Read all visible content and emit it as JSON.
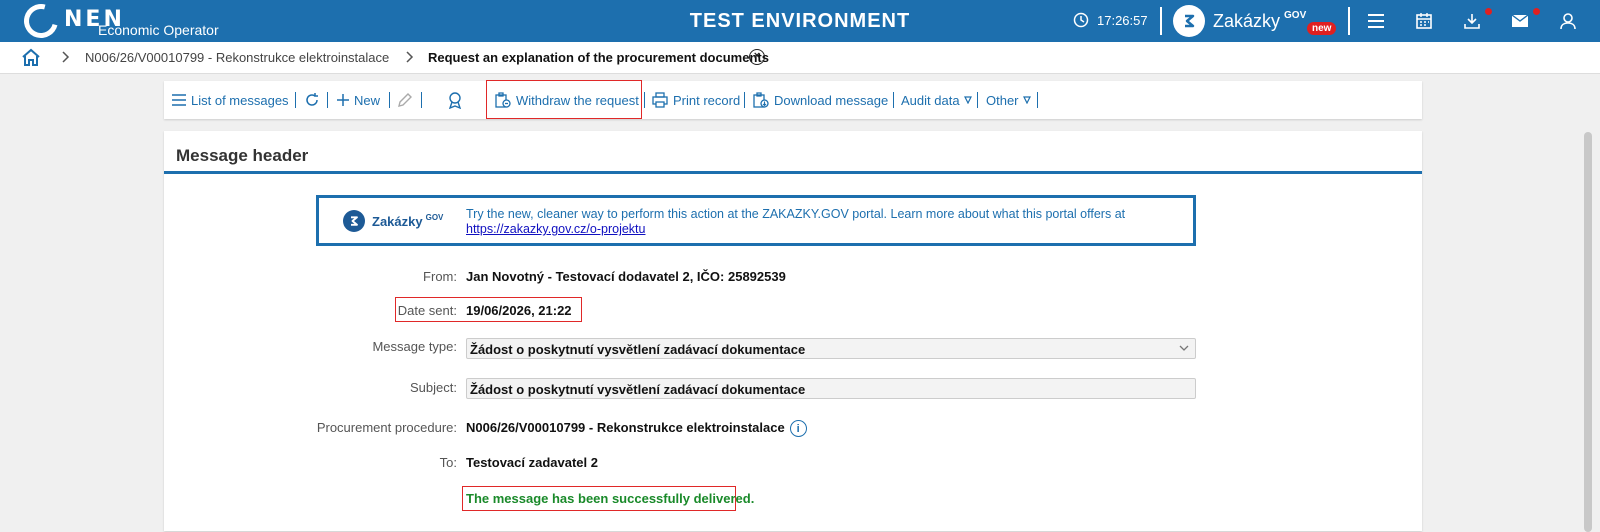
{
  "header": {
    "logo": "NEN",
    "role": "Economic Operator",
    "environment": "TEST ENVIRONMENT",
    "time": "17:26:57",
    "portal_name": "Zakázky",
    "portal_sup": "GOV",
    "portal_badge": "new",
    "icons": [
      "menu-icon",
      "calendar-icon",
      "download-icon",
      "mail-icon",
      "user-icon"
    ]
  },
  "breadcrumb": {
    "items": [
      "N006/26/V00010799 - Rekonstrukce elektroinstalace",
      "Request an explanation of the procurement documents"
    ]
  },
  "toolbar": {
    "list_messages": "List of messages",
    "new": "New",
    "withdraw": "Withdraw the request",
    "print": "Print record",
    "download": "Download message",
    "audit": "Audit data",
    "other": "Other"
  },
  "panel": {
    "title": "Message header",
    "promo_name": "Zakázky",
    "promo_sup": "GOV",
    "promo_text": "Try the new, cleaner way to perform this action at the ZAKAZKY.GOV portal. Learn more about what this portal offers at",
    "promo_link": "https://zakazky.gov.cz/o-projektu"
  },
  "form": {
    "from_label": "From:",
    "from_value": "Jan Novotný - Testovací dodavatel 2, IČO: 25892539",
    "date_label": "Date sent:",
    "date_value": "19/06/2026, 21:22",
    "type_label": "Message type:",
    "type_value": "Žádost o poskytnutí vysvětlení zadávací dokumentace",
    "subject_label": "Subject:",
    "subject_value": "Žádost o poskytnutí vysvětlení zadávací dokumentace",
    "procedure_label": "Procurement procedure:",
    "procedure_value": "N006/26/V00010799 - Rekonstrukce elektroinstalace",
    "to_label": "To:",
    "to_value": "Testovací zadavatel 2",
    "status": "The message has been successfully delivered."
  }
}
